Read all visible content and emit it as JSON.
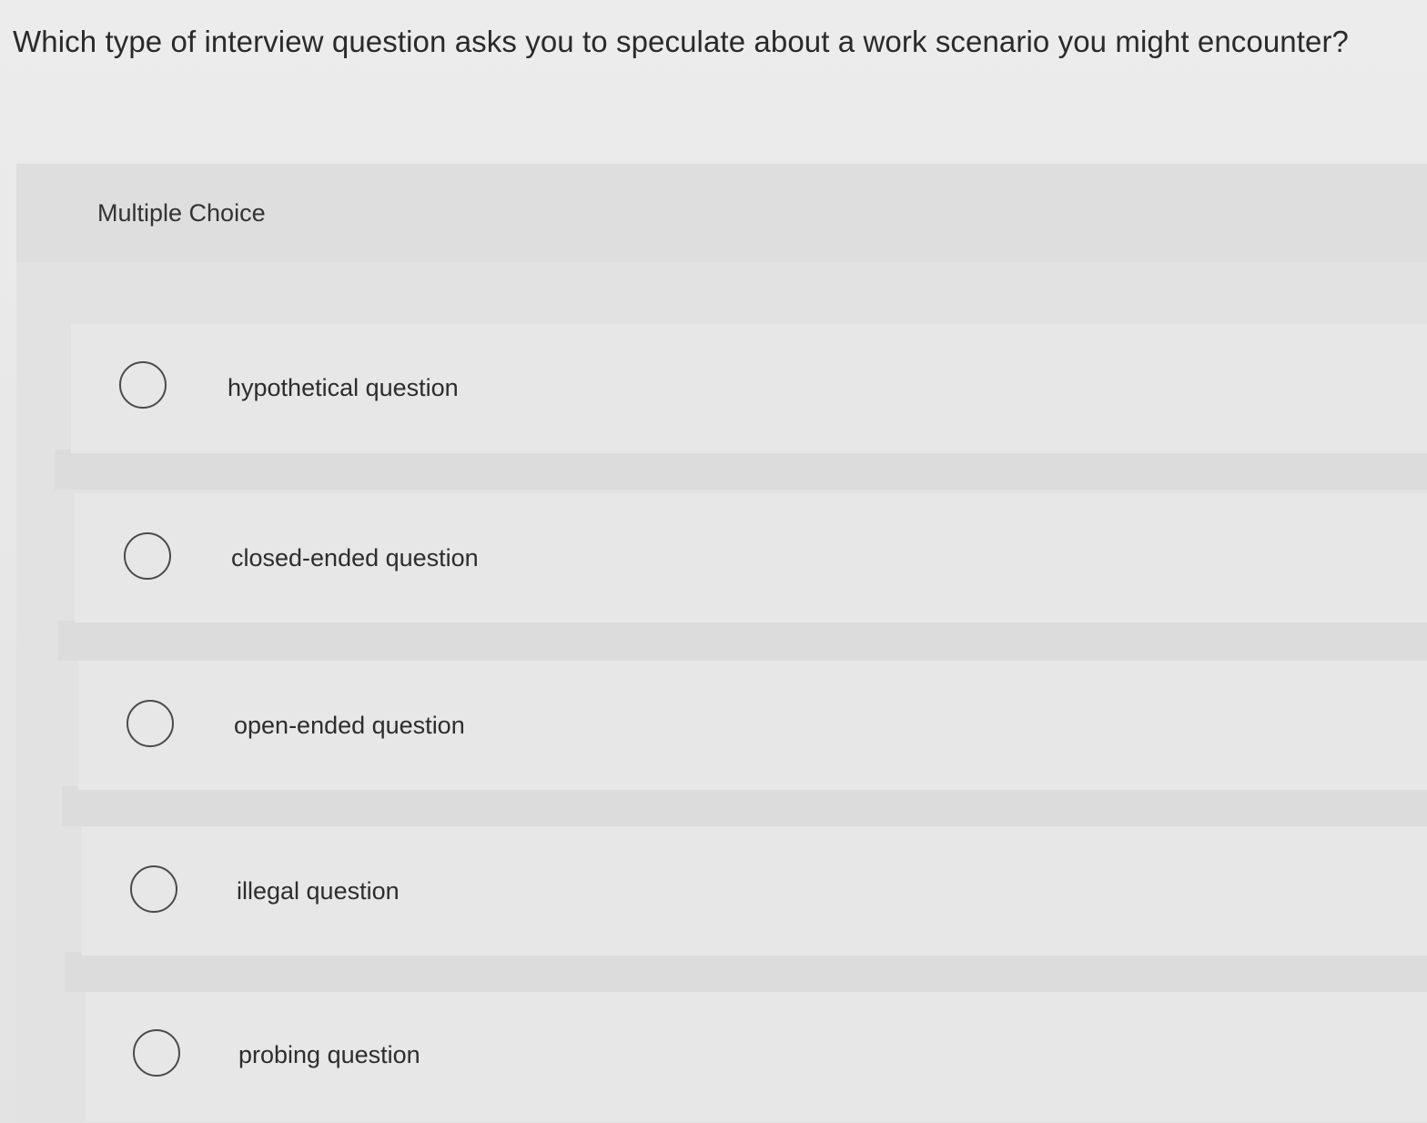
{
  "question": {
    "text": "Which type of interview question asks you to speculate about a work scenario you might encounter?"
  },
  "panel": {
    "title": "Multiple Choice"
  },
  "options": [
    {
      "label": "hypothetical question",
      "selected": false
    },
    {
      "label": "closed-ended question",
      "selected": false
    },
    {
      "label": "open-ended question",
      "selected": false
    },
    {
      "label": "illegal question",
      "selected": false
    },
    {
      "label": "probing question",
      "selected": false
    }
  ],
  "colors": {
    "background": "#e9e9e9",
    "panel": "#e2e2e2",
    "text": "#2b2b2b",
    "radio_border": "#4a4a4a"
  }
}
